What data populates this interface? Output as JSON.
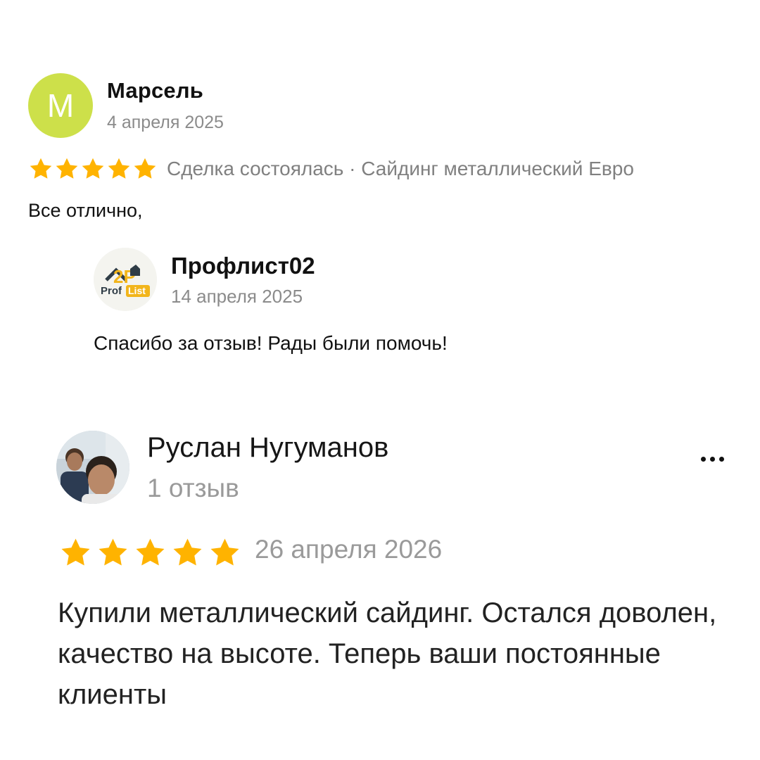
{
  "colors": {
    "star": "#ffb300",
    "avatar_m_bg": "#cde04a",
    "muted_text": "#8b8b8b"
  },
  "review1": {
    "avatar_letter": "М",
    "author": "Марсель",
    "date": "4 апреля 2025",
    "rating": 5,
    "meta": "Сделка состоялась · Сайдинг металлический Евро",
    "text": "Все отлично,"
  },
  "reply": {
    "logo_icon": "proflist-logo",
    "author": "Профлист02",
    "date": "14 апреля 2025",
    "text": "Спасибо за отзыв! Рады были помочь!"
  },
  "review2": {
    "avatar_icon": "user-photo",
    "author": "Руслан Нугуманов",
    "reviews_count": "1 отзыв",
    "more_icon": "more-horizontal-icon",
    "rating": 5,
    "date": "26 апреля 2026",
    "text": "Купили металлический сайдинг. Остался доволен, качество на высоте. Теперь ваши постоянные клиенты"
  }
}
